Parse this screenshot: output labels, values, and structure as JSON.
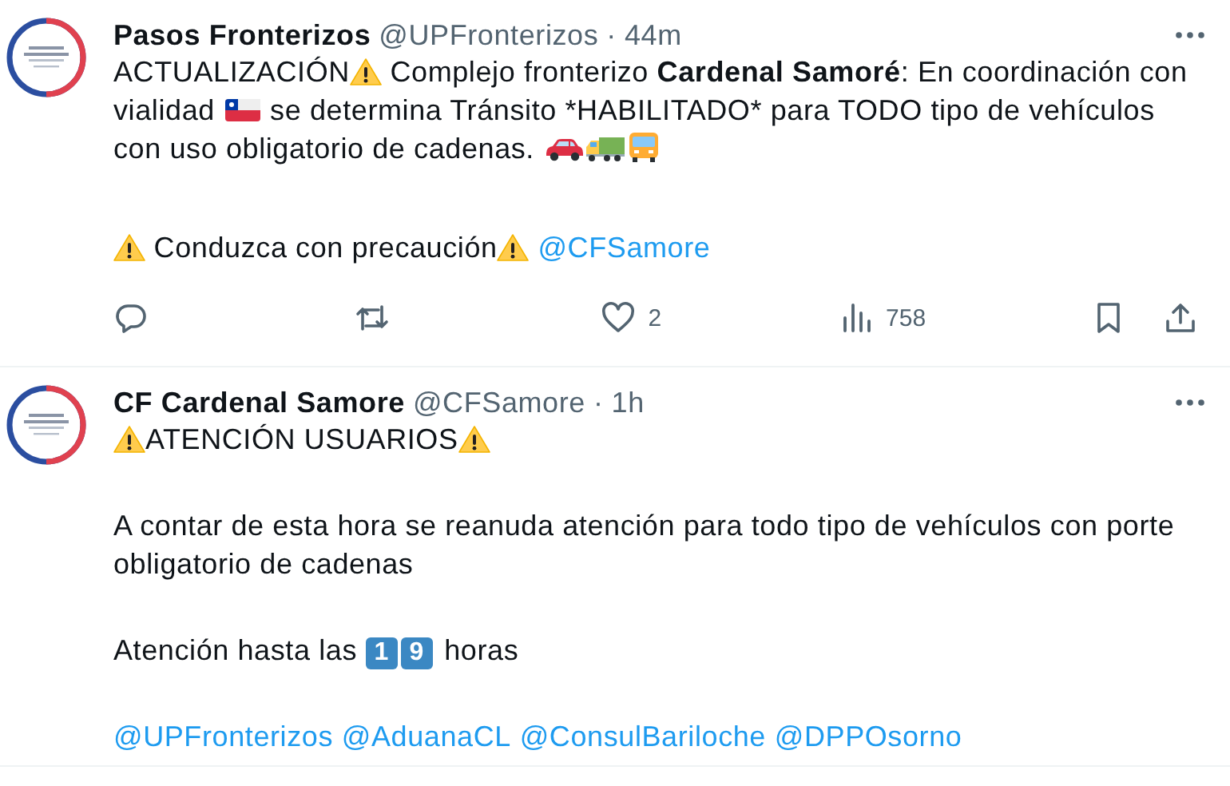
{
  "tweets": [
    {
      "author": "Pasos Fronterizos",
      "handle": "@UPFronterizos",
      "separator": "·",
      "time": "44m",
      "paragraphs": [
        [
          {
            "kind": "text",
            "text": "ACTUALIZACIÓN"
          },
          {
            "kind": "warning"
          },
          {
            "kind": "text",
            "text": " Complejo fronterizo "
          },
          {
            "kind": "bold",
            "text": "Cardenal Samoré"
          },
          {
            "kind": "text",
            "text": ": En coordinación con vialidad "
          },
          {
            "kind": "flag"
          },
          {
            "kind": "text",
            "text": " se determina Tránsito *HABILITADO* para TODO tipo de vehículos con uso obligatorio de cadenas. "
          },
          {
            "kind": "car"
          },
          {
            "kind": "truck"
          },
          {
            "kind": "bus"
          }
        ],
        [
          {
            "kind": "warning"
          },
          {
            "kind": "text",
            "text": " Conduzca con precaución"
          },
          {
            "kind": "warning"
          },
          {
            "kind": "mention",
            "text": "@CFSamore"
          }
        ]
      ],
      "actions": [
        {
          "kind": "reply"
        },
        {
          "kind": "retweet"
        },
        {
          "kind": "like",
          "count": "2"
        },
        {
          "kind": "views",
          "count": "758"
        },
        {
          "kind": "bookmark"
        },
        {
          "kind": "share"
        }
      ]
    },
    {
      "author": "CF Cardenal Samore",
      "handle": "@CFSamore",
      "separator": "·",
      "time": "1h",
      "paragraphs": [
        [
          {
            "kind": "warning"
          },
          {
            "kind": "text",
            "text": "ATENCIÓN USUARIOS"
          },
          {
            "kind": "warning"
          }
        ],
        [
          {
            "kind": "text",
            "text": "A contar de esta hora se reanuda atención para todo tipo de vehículos con porte obligatorio de cadenas"
          }
        ],
        [
          {
            "kind": "text",
            "text": "Atención hasta las "
          },
          {
            "kind": "key",
            "text": "1"
          },
          {
            "kind": "key",
            "text": "9"
          },
          {
            "kind": "text",
            "text": " horas"
          }
        ],
        [
          {
            "kind": "mention",
            "text": "@UPFronterizos"
          },
          {
            "kind": "mention",
            "text": "@AduanaCL"
          },
          {
            "kind": "mention",
            "text": "@ConsulBariloche"
          },
          {
            "kind": "mention",
            "text": "@DPPOsorno"
          }
        ]
      ]
    }
  ]
}
